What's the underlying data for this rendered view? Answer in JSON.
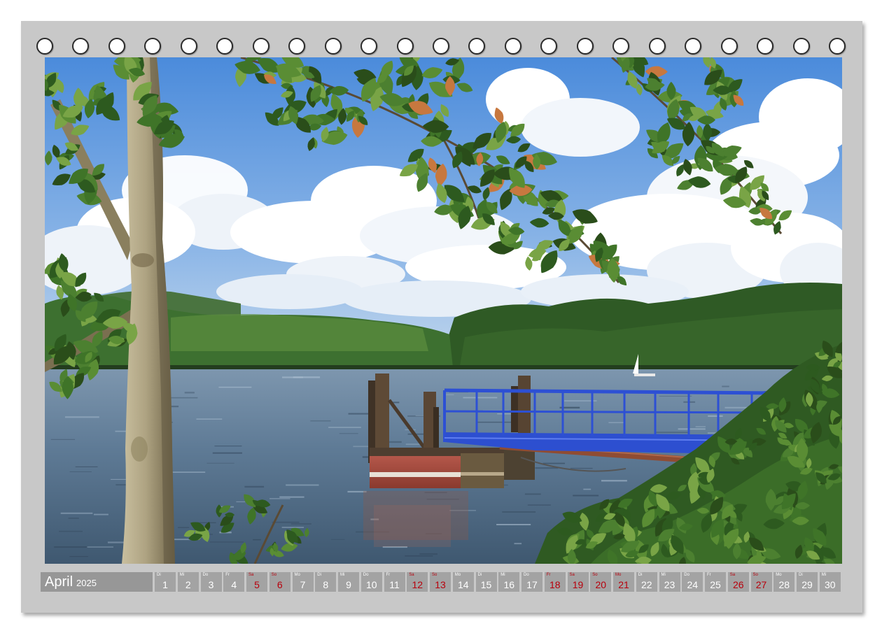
{
  "calendar": {
    "month": "April",
    "year": "2025"
  },
  "days": [
    {
      "weekday": "Di",
      "day": "1",
      "red": false
    },
    {
      "weekday": "Mi",
      "day": "2",
      "red": false
    },
    {
      "weekday": "Do",
      "day": "3",
      "red": false
    },
    {
      "weekday": "Fr",
      "day": "4",
      "red": false
    },
    {
      "weekday": "Sa",
      "day": "5",
      "red": true
    },
    {
      "weekday": "So",
      "day": "6",
      "red": true
    },
    {
      "weekday": "Mo",
      "day": "7",
      "red": false
    },
    {
      "weekday": "Di",
      "day": "8",
      "red": false
    },
    {
      "weekday": "Mi",
      "day": "9",
      "red": false
    },
    {
      "weekday": "Do",
      "day": "10",
      "red": false
    },
    {
      "weekday": "Fr",
      "day": "11",
      "red": false
    },
    {
      "weekday": "Sa",
      "day": "12",
      "red": true
    },
    {
      "weekday": "So",
      "day": "13",
      "red": true
    },
    {
      "weekday": "Mo",
      "day": "14",
      "red": false
    },
    {
      "weekday": "Di",
      "day": "15",
      "red": false
    },
    {
      "weekday": "Mi",
      "day": "16",
      "red": false
    },
    {
      "weekday": "Do",
      "day": "17",
      "red": false
    },
    {
      "weekday": "Fr",
      "day": "18",
      "red": true
    },
    {
      "weekday": "Sa",
      "day": "19",
      "red": true
    },
    {
      "weekday": "So",
      "day": "20",
      "red": true
    },
    {
      "weekday": "Mo",
      "day": "21",
      "red": true
    },
    {
      "weekday": "Di",
      "day": "22",
      "red": false
    },
    {
      "weekday": "Mi",
      "day": "23",
      "red": false
    },
    {
      "weekday": "Do",
      "day": "24",
      "red": false
    },
    {
      "weekday": "Fr",
      "day": "25",
      "red": false
    },
    {
      "weekday": "Sa",
      "day": "26",
      "red": true
    },
    {
      "weekday": "So",
      "day": "27",
      "red": true
    },
    {
      "weekday": "Mo",
      "day": "28",
      "red": false
    },
    {
      "weekday": "Di",
      "day": "29",
      "red": false
    },
    {
      "weekday": "Mi",
      "day": "30",
      "red": false
    }
  ],
  "colors": {
    "card": "#c8c8c8",
    "day_cell": "#a3a3a3",
    "month_label": "#979797",
    "red_day_text": "#b8000c",
    "ring_outline": "#2b2b2b",
    "sky": "#5b97de",
    "water": "#5f7b96",
    "gangway": "#2d50d4",
    "pier_hull": "#a24b3c"
  }
}
